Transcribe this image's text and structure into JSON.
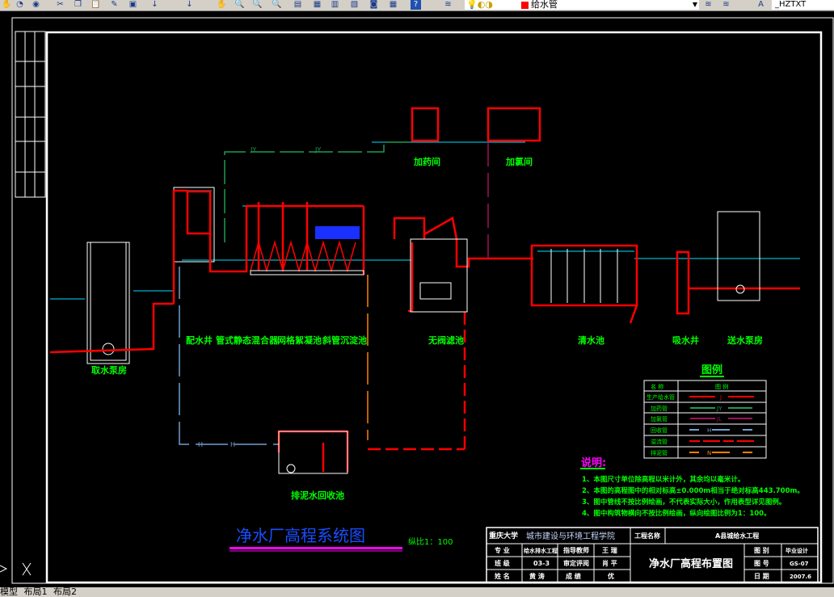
{
  "toolbar": {
    "layer_name": "给水管",
    "layer_color": "#ff0000",
    "text_style": "_HZTXT",
    "help_label": "?"
  },
  "drawing": {
    "structures": {
      "intake_pump": "取水泵房",
      "distribution_well": "配水井",
      "static_mixer": "管式静态混合器",
      "grid_flocculation": "网格絮凝池",
      "inclined_sedimentation": "斜管沉淀池",
      "valveless_filter": "无阀滤池",
      "clear_water_tank": "清水池",
      "suction_well": "吸水井",
      "delivery_pump": "送水泵房",
      "dosing_room": "加药间",
      "chlorination_room": "加氯间",
      "sludge_recovery": "排泥水回收池"
    },
    "pipe_marks": {
      "dosing": "JY",
      "chlorine": "JL",
      "recycle": "H",
      "sludge": "N",
      "supply": "J"
    },
    "title": "净水厂高程系统图",
    "scale": "纵比1：100",
    "colors": {
      "supply": "#ff0000",
      "dosing": "#1f9a50",
      "chlorine": "#a0105a",
      "recycle": "#6fa0d0",
      "sludge": "#ff8000",
      "water": "#00e0ff",
      "text": "#00ff00",
      "title": "#1a4dff"
    }
  },
  "legend": {
    "title": "图例",
    "header": [
      "名 称",
      "图 例"
    ],
    "rows": [
      {
        "name": "生产给水管",
        "mark": "J",
        "color": "#ff0000"
      },
      {
        "name": "加药管",
        "mark": "JY",
        "color": "#1f9a50"
      },
      {
        "name": "加氯管",
        "mark": "JL",
        "color": "#a0105a"
      },
      {
        "name": "回收管",
        "mark": "H",
        "color": "#6fa0d0"
      },
      {
        "name": "溢流管",
        "mark": "",
        "color": "#ff0000"
      },
      {
        "name": "排泥管",
        "mark": "N",
        "color": "#ff8000"
      }
    ]
  },
  "notes": {
    "title": "说明:",
    "items": [
      "1、本图尺寸单位除高程以米计外，其余均以毫米计。",
      "2、本图的高程图中的相对标高±0.000m相当于绝对标高443.700m。",
      "3、图中管线不按比例绘画，不代表实际大小，作用表型详见图例。",
      "4、图中构筑物横向不按比例绘画，纵向绘图比例为1：100。"
    ]
  },
  "title_block": {
    "school": "城市建设与环境工程学院",
    "project_label": "工程名称",
    "project": "A县城给水工程",
    "major_label": "专 业",
    "major": "给水排水工程",
    "advisor_label": "指导教师",
    "advisor": "王 瑞",
    "class_label": "班 级",
    "class": "03-3",
    "reviewer_label": "审定评阅",
    "reviewer": "肖 平",
    "name_label": "姓 名",
    "name": "黄 涛",
    "grade_label": "成 绩",
    "grade": "优",
    "drawing_title": "净水厂高程布置图",
    "category_label": "图 别",
    "category": "毕业设计",
    "number_label": "图 号",
    "number": "GS-07",
    "date_label": "日 期",
    "date": "2007.6"
  },
  "tabs": [
    "模型",
    "布局1",
    "布局2"
  ]
}
